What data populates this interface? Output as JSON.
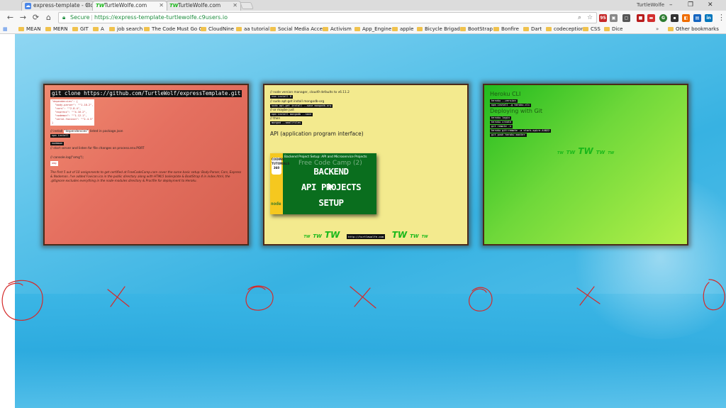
{
  "browser": {
    "tabs": [
      {
        "title": "express-template - Cloud",
        "favicon": "cloud9",
        "active": false
      },
      {
        "title": "TurtleWolfe.com",
        "favicon": "TW",
        "active": true
      },
      {
        "title": "TurtleWolfe.com",
        "favicon": "TW",
        "active": false
      }
    ],
    "profile_name": "TurtleWolfe",
    "window_controls": {
      "minimize": "–",
      "restore": "❐",
      "close": "✕"
    },
    "nav": {
      "back": "←",
      "forward": "→",
      "reload": "⟳"
    },
    "address": {
      "secure_label": "Secure",
      "url": "https://express-template-turtlewolfe.c9users.io"
    },
    "bookmarks": [
      "MEAN",
      "MERN",
      "GIT",
      "A",
      "job search",
      "The Code Must Go O",
      "CloudNine",
      "aa tutorial",
      "Social Media Access",
      "Activism",
      "App_Engine",
      "apple",
      "Bicycle Brigade",
      "BootStrap",
      "Bonfire",
      "Dart",
      "codeception",
      "CSS",
      "Dice"
    ],
    "bookmarks_more": "»",
    "other_bookmarks": "Other bookmarks"
  },
  "cards": {
    "card1": {
      "title": "git clone https://github.com/TurtleWolf/expressTemplate.git",
      "package_json": "\"dependencies\": {\n  \"body-parser\": \"^1.18.2\",\n  \"cors\": \"^2.8.4\",\n  \"express\": \"^4.16.2\",\n  \"nodemon\": \"^1.12.1\",\n  \"serve-favicon\": \"^2.4.5\"\n}",
      "install_note_pre": "// install ",
      "install_note_key": "\"dependencies\"",
      "install_note_post": " listed in package.json",
      "npm_install": "npm install",
      "nodemon": "nodemon",
      "start_note": "// start server and listen for file changes on process.env.PORT",
      "console_log": "// console.log(\"omg\");",
      "omg": "omg",
      "paragraph": "The first 5 out of 10 assignments to get certified at FreeCodeCamp.com cover the same basic setup: Body-Parser, Cors, Express & Nodemon. I've added Favicon.ico in the public directory along with HTML5 boilerplate & BootStrap 4 in index.html, the .gitignore excludes everything in the node-modules directory & Procfile for deployment to Heroku."
    },
    "card2": {
      "c1": "// node version manager, cloud9 defaults to v6.11.2",
      "nvm": "nvm install 8",
      "c2": "// sudo apt-get install mongodb-org",
      "apt": "sudo apt-get install --save mongodb-org",
      "c3": "// or maybe just",
      "npm_mongo": "npm install mongodb --save",
      "c4": "// then",
      "mongod": "mongod --smallfiles",
      "api_heading": "API (application program interface)",
      "video_title": "Backend Project Setup: API and Microservice Projects",
      "video_overlay": "Free Code Camp (2)",
      "video_lines": [
        "BACKEND",
        "API PROJECTS",
        "SETUP"
      ],
      "video_spine": "CODING TUTORIALS 360",
      "video_node": "node",
      "tw_words": [
        "TW",
        "TW",
        "TW"
      ],
      "link": "http://turtlewolfe.com",
      "tw_words_right": [
        "TW",
        "TW",
        "TW"
      ]
    },
    "card3": {
      "heading1": "Heroku CLI",
      "cmd1": "heroku --version",
      "cmd2": "npm install -g heroku-cli",
      "heading2": "Deploying with Git",
      "cmd3": "heroku login",
      "cmd4": "heroku create",
      "cmd5": "git remote -v",
      "cmd6": "heroku git:remote -a stark-spire-44022",
      "cmd7": "git push heroku master",
      "tw_words": [
        "TW",
        "TW",
        "TW",
        "TW",
        "TW"
      ]
    }
  },
  "colors": {
    "card1_bg": "#e57060",
    "card2_bg": "#f3ea8e",
    "card3_bg": "#6fd83a",
    "page_bg": "#37b2e2",
    "annotation_red": "#d42a2a",
    "tw_green": "#1ab81a"
  },
  "annotations": [
    "circle",
    "x",
    "circle",
    "x",
    "circle",
    "x",
    "circle"
  ]
}
